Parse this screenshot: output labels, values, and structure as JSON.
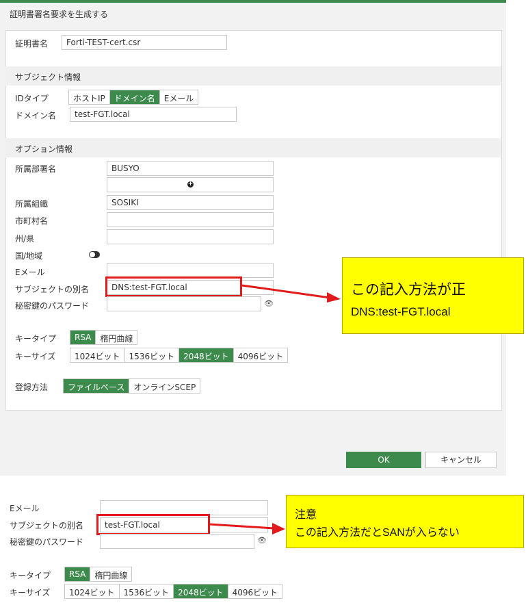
{
  "dialog": {
    "title": "証明書署名要求を生成する",
    "cert_name_label": "証明書名",
    "cert_name_value": "Forti-TEST-cert.csr",
    "subject_section": "サブジェクト情報",
    "id_type_label": "IDタイプ",
    "id_type_options": [
      "ホストIP",
      "ドメイン名",
      "Eメール"
    ],
    "id_type_selected": "ドメイン名",
    "domain_label": "ドメイン名",
    "domain_value": "test-FGT.local",
    "optional_section": "オプション情報",
    "org_unit_label": "所属部署名",
    "org_unit_value": "BUSYO",
    "org_label": "所属組織",
    "org_value": "SOSIKI",
    "locality_label": "市町村名",
    "state_label": "州/県",
    "country_label": "国/地域",
    "email_label": "Eメール",
    "san_label": "サブジェクトの別名",
    "san_value": "DNS:test-FGT.local",
    "password_label": "秘密鍵のパスワード",
    "key_type_label": "キータイプ",
    "key_type_options": [
      "RSA",
      "楕円曲線"
    ],
    "key_type_selected": "RSA",
    "key_size_label": "キーサイズ",
    "key_size_options": [
      "1024ビット",
      "1536ビット",
      "2048ビット",
      "4096ビット"
    ],
    "key_size_selected": "2048ビット",
    "enroll_label": "登録方法",
    "enroll_options": [
      "ファイルベース",
      "オンラインSCEP"
    ],
    "enroll_selected": "ファイルベース",
    "ok_label": "OK",
    "cancel_label": "キャンセル"
  },
  "callout_correct": {
    "line1": "この記入方法が正",
    "line2": "DNS:test-FGT.local"
  },
  "lower": {
    "email_label": "Eメール",
    "san_label": "サブジェクトの別名",
    "san_value": "test-FGT.local",
    "password_label": "秘密鍵のパスワード",
    "key_type_label": "キータイプ",
    "key_type_options": [
      "RSA",
      "楕円曲線"
    ],
    "key_size_label": "キーサイズ",
    "key_size_options": [
      "1024ビット",
      "1536ビット",
      "2048ビット",
      "4096ビット"
    ]
  },
  "callout_warning": {
    "line1": "注意",
    "line2": "この記入方法だとSANが入らない"
  },
  "colors": {
    "accent": "#3c8a4c",
    "highlight": "#ffff00",
    "annotation_red": "#e11b1b"
  }
}
